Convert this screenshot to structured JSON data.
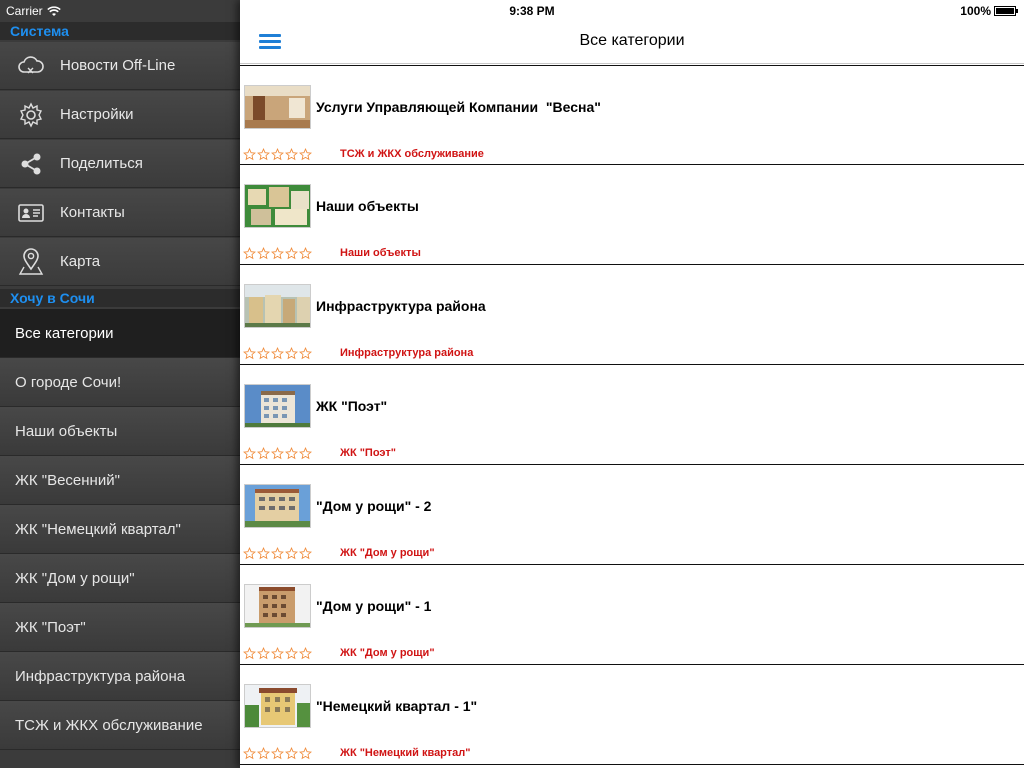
{
  "status": {
    "carrier": "Carrier",
    "time": "9:38 PM",
    "battery": "100%"
  },
  "sidebar": {
    "section_system": "Система",
    "system_items": [
      {
        "label": "Новости Off-Line",
        "icon": "cloud-offline-icon"
      },
      {
        "label": "Настройки",
        "icon": "gear-icon"
      },
      {
        "label": "Поделиться",
        "icon": "share-icon"
      },
      {
        "label": "Контакты",
        "icon": "contact-card-icon"
      },
      {
        "label": "Карта",
        "icon": "map-pin-icon"
      }
    ],
    "section_sochi": "Хочу в Сочи",
    "categories": [
      {
        "label": "Все категории",
        "active": true
      },
      {
        "label": "О городе Сочи!"
      },
      {
        "label": "Наши объекты"
      },
      {
        "label": "ЖК \"Весенний\""
      },
      {
        "label": "ЖК \"Немецкий квартал\""
      },
      {
        "label": "ЖК \"Дом у рощи\""
      },
      {
        "label": "ЖК \"Поэт\""
      },
      {
        "label": "Инфраструктура района"
      },
      {
        "label": "ТСЖ и ЖКХ обслуживание"
      }
    ]
  },
  "navbar": {
    "title": "Все категории",
    "menu_icon": "hamburger-menu-icon"
  },
  "colors": {
    "accent_blue": "#1f7fd6",
    "section_blue": "#1e8ff0",
    "category_red": "#d01414",
    "star_orange": "#f08c3c"
  },
  "list": [
    {
      "title": "Услуги Управляющей Компании  \"Весна\"",
      "category": "ТСЖ и ЖКХ обслуживание",
      "rating": 0
    },
    {
      "title": "Наши объекты",
      "category": "Наши объекты",
      "rating": 0
    },
    {
      "title": "Инфраструктура района",
      "category": "Инфраструктура района",
      "rating": 0
    },
    {
      "title": "ЖК \"Поэт\"",
      "category": "ЖК \"Поэт\"",
      "rating": 0
    },
    {
      "title": "\"Дом у рощи\" - 2",
      "category": "ЖК \"Дом у рощи\"",
      "rating": 0
    },
    {
      "title": "\"Дом у рощи\" - 1",
      "category": "ЖК \"Дом у рощи\"",
      "rating": 0
    },
    {
      "title": "\"Немецкий квартал - 1\"",
      "category": "ЖК \"Немецкий квартал\"",
      "rating": 0
    }
  ]
}
